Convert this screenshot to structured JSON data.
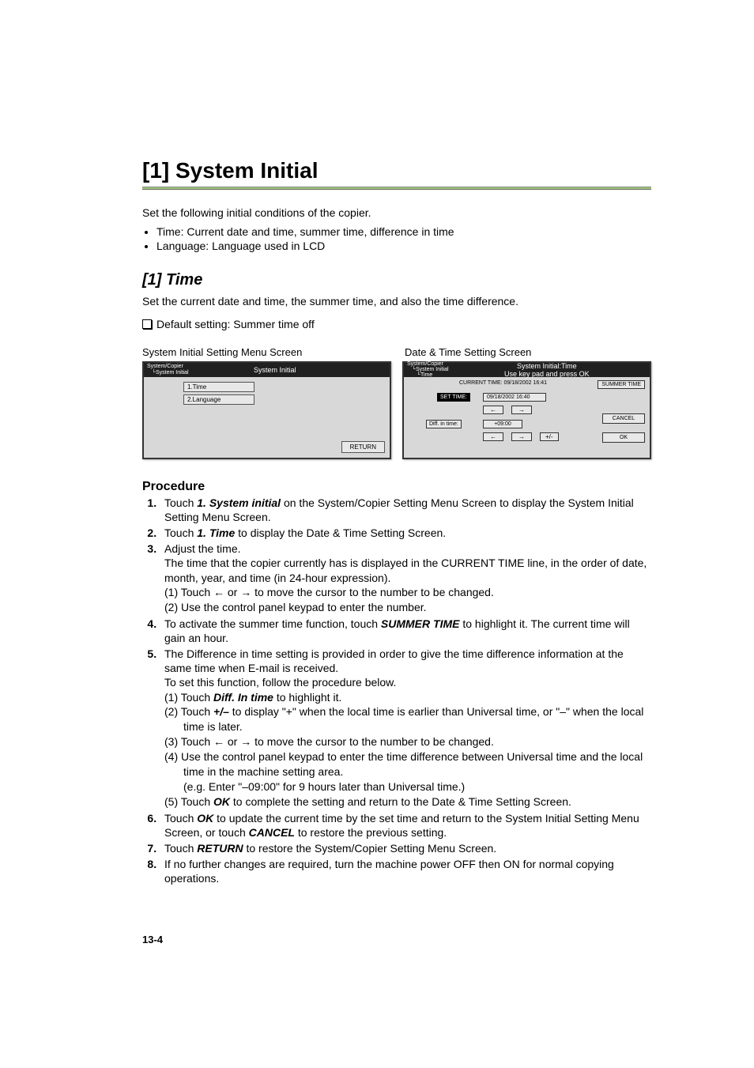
{
  "heading": {
    "title": "[1] System Initial"
  },
  "intro": {
    "p1": "Set the following initial conditions of the copier.",
    "b1": "Time: Current date and time, summer time, difference in time",
    "b2": "Language: Language used in LCD"
  },
  "sub": {
    "title": "[1] Time",
    "p1": "Set the current date and time, the summer time, and also the time difference.",
    "note": "Default setting: Summer time off"
  },
  "screen_labels": {
    "left": "System Initial Setting Menu Screen",
    "right": "Date & Time Setting Screen"
  },
  "screen1": {
    "bc1": "System/Copier",
    "bc2": "System Initial",
    "title": "System Initial",
    "item1": "1.Time",
    "item2": "2.Language",
    "return": "RETURN"
  },
  "screen2": {
    "bc1": "System/Copier",
    "bc2": "System Initial",
    "bc3": "Time",
    "title1": "System Initial:Time",
    "title2": "Use key pad and press OK",
    "current": "CURRENT TIME: 09/18/2002 16:41",
    "set_label": "SET TIME:",
    "set_value": "09/18/2002 16:40",
    "arrow_left": "←",
    "arrow_right": "→",
    "diff_label": "Diff. in time:",
    "diff_value": "+09:00",
    "plusminus": "+/-",
    "summer": "SUMMER TIME",
    "cancel": "CANCEL",
    "ok": "OK"
  },
  "procedure": {
    "heading": "Procedure",
    "steps": {
      "s1a": "Touch ",
      "s1b": "1. System initial",
      "s1c": " on the System/Copier Setting Menu Screen to display the System Initial Setting Menu Screen.",
      "s2a": "Touch ",
      "s2b": "1. Time",
      "s2c": " to display the Date & Time Setting Screen.",
      "s3a": "Adjust the time.",
      "s3b": "The time that the copier currently has is displayed in the CURRENT TIME line, in the order of date, month, year, and time (in 24-hour expression).",
      "s3c1a": "(1)  Touch ",
      "s3c1b": " or ",
      "s3c1c": " to move the cursor to the number to be changed.",
      "s3c2": "(2)  Use the control panel keypad to enter the number.",
      "s4a": "To activate the summer time function, touch ",
      "s4b": "SUMMER TIME",
      "s4c": " to highlight it. The current time will gain an hour.",
      "s5a": "The Difference in time setting is provided in order to give the time difference information at the same time when E-mail is received.",
      "s5b": "To set this function, follow the procedure below.",
      "s5c1a": "(1)  Touch ",
      "s5c1b": "Diff. In time",
      "s5c1c": " to highlight it.",
      "s5c2a": "(2)  Touch ",
      "s5c2b": "+/–",
      "s5c2c": " to display \"+\" when the local time is earlier than Universal time, or \"–\" when the local time is later.",
      "s5c3a": "(3)  Touch ",
      "s5c3b": " or ",
      "s5c3c": " to move the cursor to the number to be changed.",
      "s5c4a": "(4)  Use the control panel keypad to enter the time difference between Universal time and the local time in the machine setting area.",
      "s5c4b": "(e.g. Enter \"–09:00\" for 9 hours later than Universal time.)",
      "s5c5a": "(5)  Touch ",
      "s5c5b": "OK",
      "s5c5c": " to complete the setting and return to the Date & Time Setting Screen.",
      "s6a": "Touch ",
      "s6b": "OK",
      "s6c": " to update the current time by the set time and return to the System Initial Setting Menu Screen, or touch ",
      "s6d": "CANCEL",
      "s6e": " to restore the previous setting.",
      "s7a": "Touch ",
      "s7b": "RETURN",
      "s7c": " to restore the System/Copier Setting Menu Screen.",
      "s8": "If no further changes are required, turn the machine power OFF then ON for normal copying operations."
    },
    "arrows": {
      "left": "←",
      "right": "→"
    }
  },
  "pagenum": "13-4"
}
